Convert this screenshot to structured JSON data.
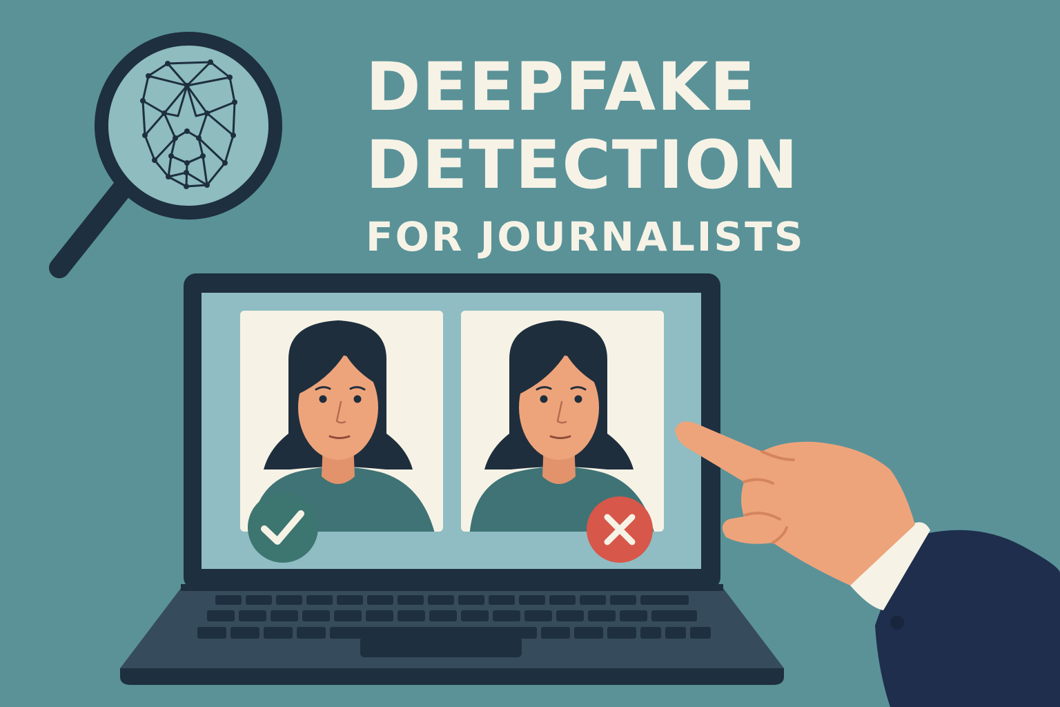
{
  "headline": {
    "line1": "DEEPFAKE",
    "line2": "DETECTION",
    "line3": "FOR JOURNALISTS"
  },
  "colors": {
    "background": "#5a9298",
    "title_text": "#f6f3e6",
    "dark_navy": "#1e2f3f",
    "screen": "#8fbdc3",
    "photo_card": "#f6f3e6",
    "hair": "#1f2e3d",
    "skin": "#eea47b",
    "shirt": "#3f7375",
    "check_badge": "#3d7570",
    "cross_badge": "#d7574a",
    "suit": "#1f2e4c"
  },
  "icons": {
    "magnifier": "magnifier-icon",
    "face_mesh": "face-mesh-icon",
    "real_badge": "check-icon",
    "fake_badge": "cross-icon"
  },
  "photos": [
    {
      "label": "real-photo",
      "verdict": "authentic"
    },
    {
      "label": "fake-photo",
      "verdict": "deepfake"
    }
  ]
}
